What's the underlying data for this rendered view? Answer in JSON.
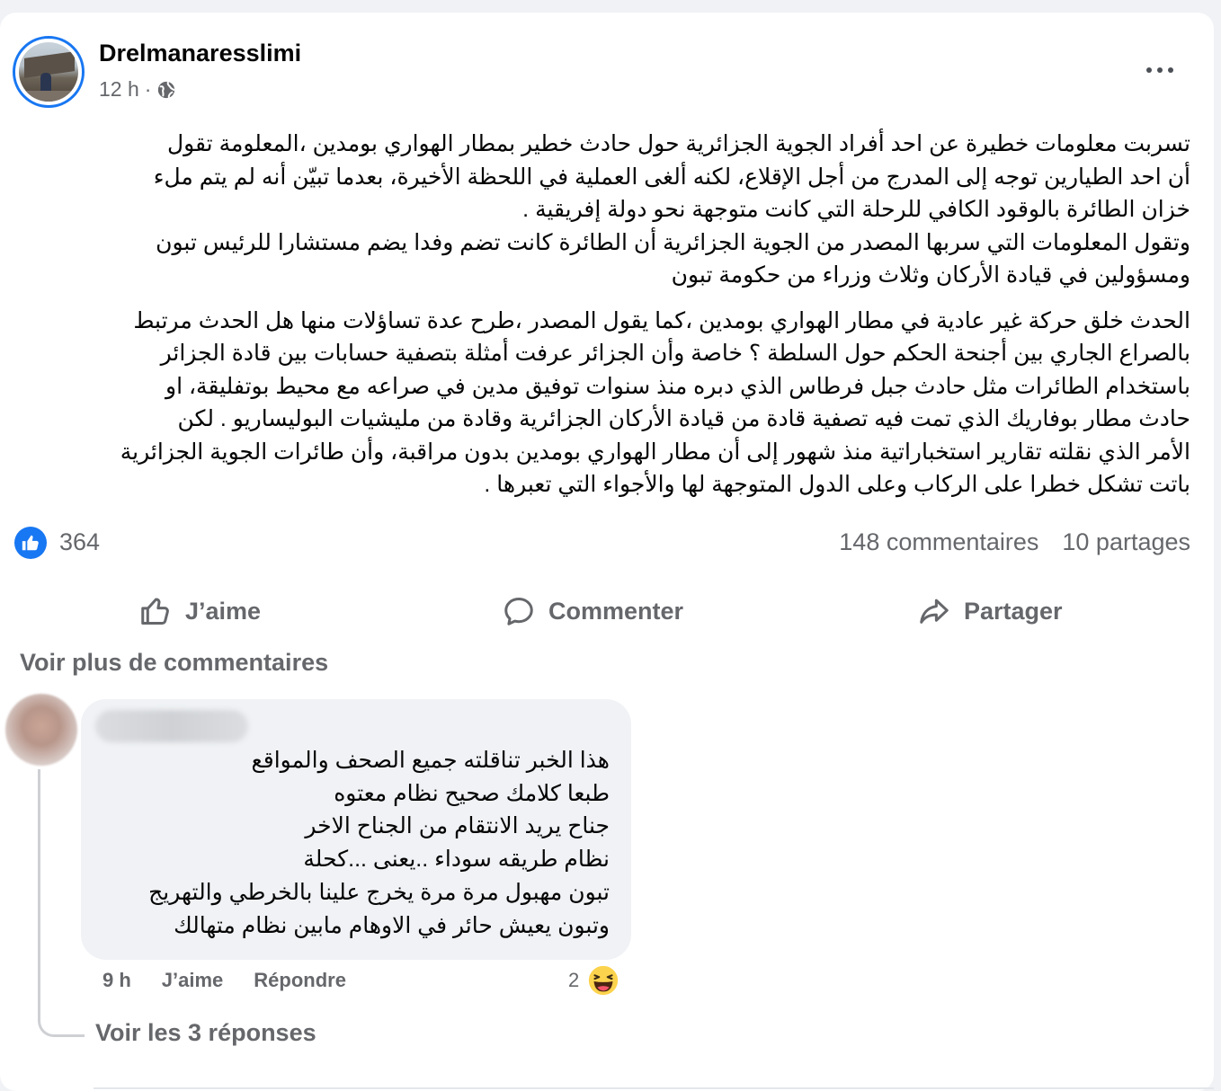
{
  "post": {
    "author": "Drelmanaresslimi",
    "time": "12 h",
    "separator": "·",
    "paragraphs": [
      [
        "تسربت معلومات  خطيرة عن احد أفراد الجوية الجزائرية حول  حادث خطير بمطار الهواري بومدين ،المعلومة تقول",
        "أن احد الطيارين توجه إلى المدرج من أجل الإقلاع، لكنه ألغى العملية في اللحظة الأخيرة، بعدما تبيّن أنه لم يتم ملء",
        "خزان الطائرة بالوقود الكافي للرحلة التي كانت متوجهة نحو دولة إفريقية .",
        " وتقول المعلومات التي سربها المصدر من الجوية الجزائرية أن الطائرة كانت تضم وفدا  يضم مستشارا للرئيس تبون",
        "ومسؤولين في قيادة الأركان وثلاث وزراء من حكومة تبون"
      ],
      [
        "الحدث خلق حركة غير عادية في مطار الهواري بومدين ،كما يقول المصدر ،طرح عدة تساؤلات منها هل الحدث مرتبط",
        "بالصراع الجاري بين أجنحة الحكم حول السلطة ؟ خاصة وأن الجزائر عرفت أمثلة بتصفية حسابات بين قادة الجزائر",
        "باستخدام الطائرات مثل حادث جبل فرطاس الذي دبره منذ سنوات توفيق مدين في صراعه مع محيط بوتفليقة، او",
        "حادث مطار بوفاريك الذي تمت فيه تصفية قادة من قيادة الأركان الجزائرية وقادة من مليشيات البوليساريو . لكن",
        "الأمر الذي نقلته تقارير استخباراتية منذ شهور إلى أن مطار الهواري بومدين بدون مراقبة، وأن طائرات الجوية الجزائرية",
        "باتت تشكل خطرا على الركاب وعلى الدول المتوجهة لها والأجواء التي تعبرها ."
      ]
    ]
  },
  "reactions": {
    "likes": "364",
    "comments": "148 commentaires",
    "shares": "10 partages"
  },
  "actions": {
    "like": "J’aime",
    "comment": "Commenter",
    "share": "Partager"
  },
  "comments_section": {
    "more_label": "Voir plus de commentaires",
    "comment": {
      "lines": [
        "هذا الخبر تناقلته جميع الصحف والمواقع",
        "طبعا كلامك صحيح نظام معتوه",
        "جناح يريد الانتقام من الجناح الاخر",
        "نظام طريقه سوداء ..يعنى ...كحلة",
        "تبون مهبول مرة مرة يخرج علينا بالخرطي والتهريج",
        "وتبون يعيش حائر في الاوهام مابين نظام متهالك"
      ],
      "time": "9 h",
      "like_label": "J’aime",
      "reply_label": "Répondre",
      "reaction_count": "2",
      "reaction_icon": "haha-emoji-icon"
    },
    "replies_label": "Voir les 3 réponses"
  },
  "colors": {
    "accent": "#1877f2",
    "secondary_text": "#65676b",
    "bubble": "#f0f2f5"
  }
}
